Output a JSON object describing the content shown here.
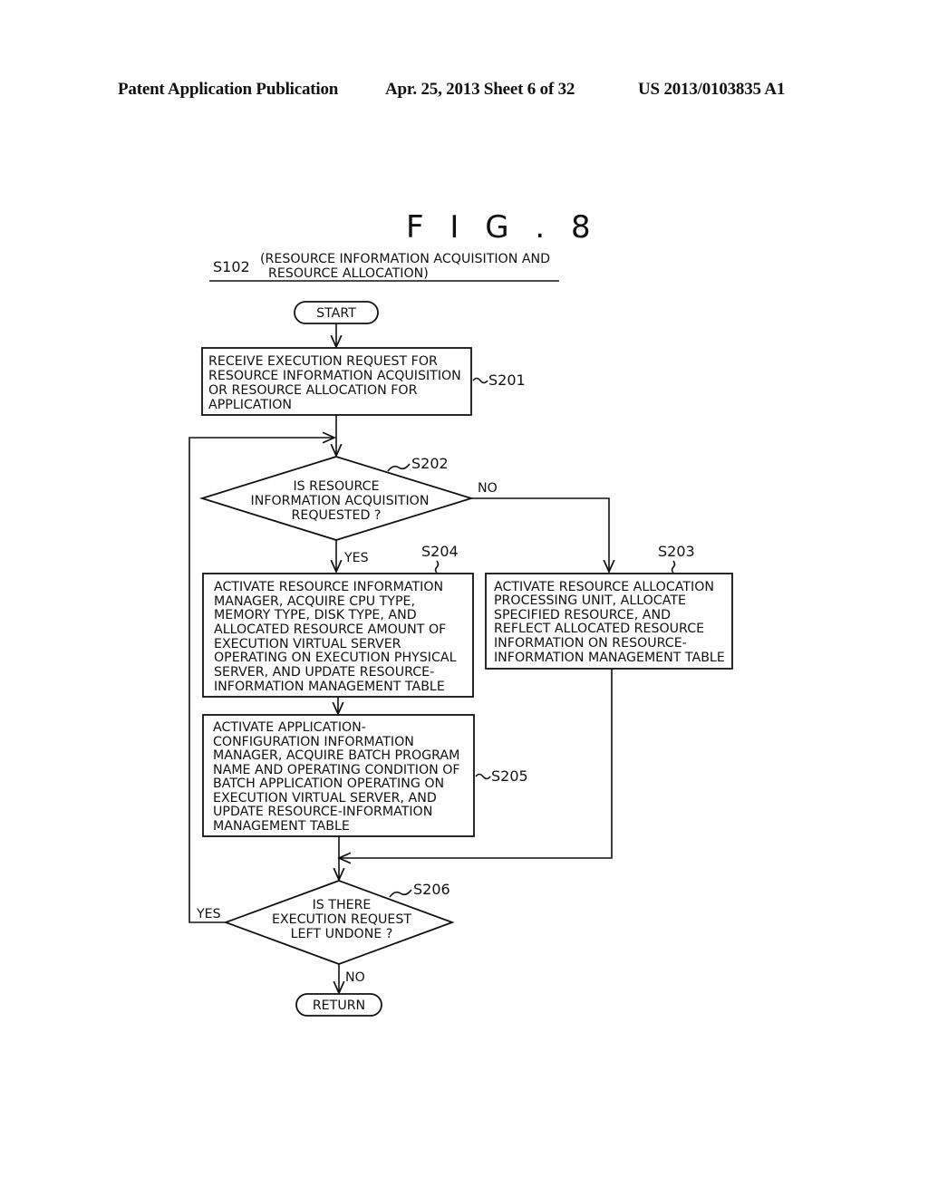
{
  "header": {
    "publication": "Patent Application Publication",
    "date_sheet": "Apr. 25, 2013  Sheet 6 of 32",
    "number": "US 2013/0103835 A1"
  },
  "figure": {
    "title": "F I G . 8",
    "step_id": "S102",
    "caption_lines": [
      "(RESOURCE INFORMATION ACQUISITION AND",
      "RESOURCE ALLOCATION)"
    ]
  },
  "flowchart": {
    "start": "START",
    "end": "RETURN",
    "s201": {
      "label": "S201",
      "lines": [
        "RECEIVE EXECUTION REQUEST FOR",
        "RESOURCE INFORMATION ACQUISITION",
        "OR RESOURCE ALLOCATION FOR",
        "APPLICATION"
      ]
    },
    "s202": {
      "label": "S202",
      "lines": [
        "IS RESOURCE",
        "INFORMATION ACQUISITION",
        "REQUESTED ?"
      ],
      "yes": "YES",
      "no": "NO"
    },
    "s203": {
      "label": "S203",
      "lines": [
        "ACTIVATE RESOURCE ALLOCATION",
        "PROCESSING UNIT, ALLOCATE",
        "SPECIFIED RESOURCE, AND",
        "REFLECT ALLOCATED RESOURCE",
        "INFORMATION ON RESOURCE-",
        "INFORMATION MANAGEMENT TABLE"
      ]
    },
    "s204": {
      "label": "S204",
      "lines": [
        "ACTIVATE RESOURCE INFORMATION",
        "MANAGER, ACQUIRE CPU TYPE,",
        "MEMORY TYPE, DISK TYPE, AND",
        "ALLOCATED RESOURCE AMOUNT OF",
        "EXECUTION VIRTUAL SERVER",
        "OPERATING ON EXECUTION PHYSICAL",
        "SERVER, AND UPDATE RESOURCE-",
        "INFORMATION MANAGEMENT TABLE"
      ]
    },
    "s205": {
      "label": "S205",
      "lines": [
        "ACTIVATE APPLICATION-",
        "CONFIGURATION INFORMATION",
        "MANAGER, ACQUIRE BATCH PROGRAM",
        "NAME AND OPERATING CONDITION OF",
        "BATCH APPLICATION OPERATING ON",
        "EXECUTION VIRTUAL SERVER, AND",
        "UPDATE RESOURCE-INFORMATION",
        "MANAGEMENT TABLE"
      ]
    },
    "s206": {
      "label": "S206",
      "lines": [
        "IS THERE",
        "EXECUTION REQUEST",
        "LEFT UNDONE ?"
      ],
      "yes": "YES",
      "no": "NO"
    }
  }
}
